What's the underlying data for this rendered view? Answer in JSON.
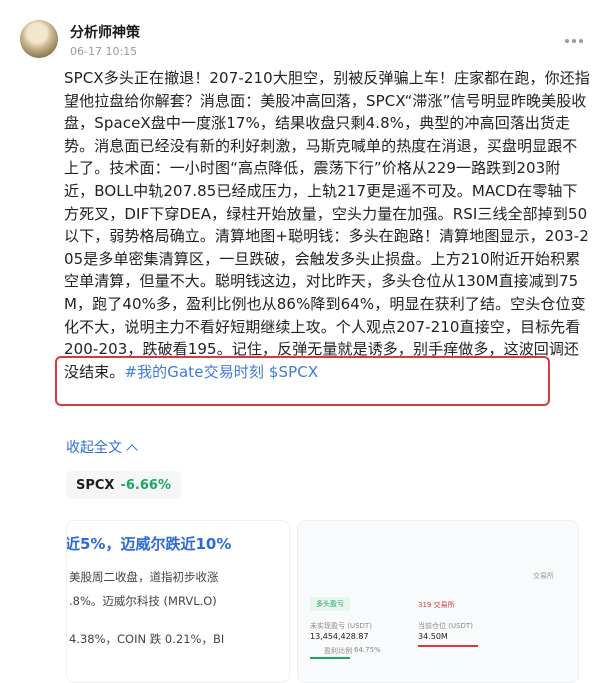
{
  "author": {
    "name": "分析师神策",
    "time": "06-17 10:15"
  },
  "post": {
    "body": "SPCX多头正在撤退！207-210大胆空，别被反弹骗上车！庄家都在跑，你还指望他拉盘给你解套？消息面：美股冲高回落，SPCX“滞涨”信号明显昨晚美股收盘，SpaceX盘中一度涨17%，结果收盘只剩4.8%，典型的冲高回落出货走势。消息面已经没有新的利好刺激，马斯克喊单的热度在消退，买盘明显跟不上了。技术面：一小时图“高点降低，震荡下行”价格从229一路跌到203附近，BOLL中轨207.85已经成压力，上轨217更是遥不可及。MACD在零轴下方死叉，DIF下穿DEA，绿柱开始放量，空头力量在加强。RSI三线全部掉到50以下，弱势格局确立。清算地图+聪明钱：多头在跑路！清算地图显示，203-205是多单密集清算区，一旦跌破，会触发多头止损盘。上方210附近开始积累空单清算，但量不大。聪明钱这边，对比昨天，多头仓位从130M直接减到75M，跑了40%多，盈利比例也从86%降到64%，明显在获利了结。空头仓位变化不大，说明主力不看好短期继续上攻。个人观点207-210直接空，目标先看200-203，跌破看195。记住，反弹无量就是诱多，别手痒做多，这波回调还没结束。",
    "tag": "#我的Gate交易时刻 $SPCX",
    "collapse_label": "收起全文"
  },
  "ticker": {
    "symbol": "SPCX",
    "change": "-6.66%",
    "change_color": "#1fa462"
  },
  "news_card": {
    "headline": "近5%，迈威尔跌近10%",
    "line1": "美股周二收盘，道指初步收涨",
    "line2": ".8%。迈威尔科技 (MRVL.O)",
    "line3": "4.38%，COIN 跌 0.21%，BI"
  },
  "data_card": {
    "header_green": "多头盈亏",
    "header_red": "319 交易所",
    "unrealized_label": "未实现盈亏 (USDT)",
    "unrealized_value": "13,454,428.87",
    "current_label": "当前仓位 (USDT)",
    "current_value": "34.50M",
    "ratio_label": "盈利比例",
    "ratio_value": "64.75%",
    "corner_label": "交易所"
  },
  "colors": {
    "accent_blue": "#2f6fd6",
    "highlight_red": "#d9393e"
  }
}
